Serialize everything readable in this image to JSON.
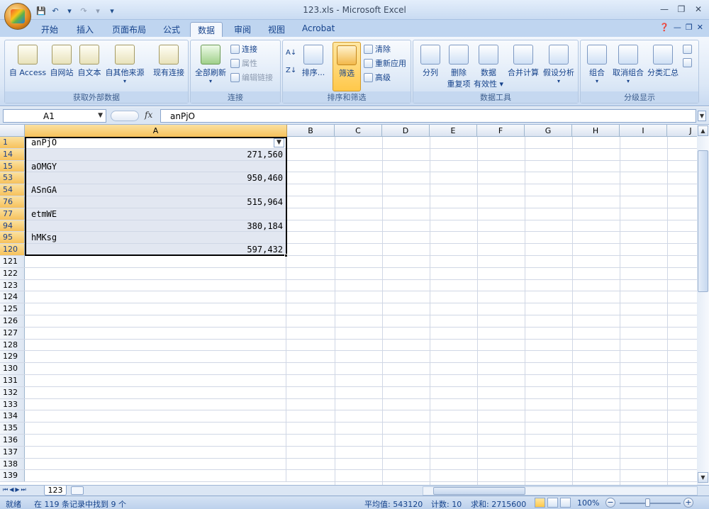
{
  "window": {
    "title": "123.xls - Microsoft Excel"
  },
  "tabs": [
    {
      "label": "开始",
      "active": false
    },
    {
      "label": "插入",
      "active": false
    },
    {
      "label": "页面布局",
      "active": false
    },
    {
      "label": "公式",
      "active": false
    },
    {
      "label": "数据",
      "active": true
    },
    {
      "label": "审阅",
      "active": false
    },
    {
      "label": "视图",
      "active": false
    },
    {
      "label": "Acrobat",
      "active": false
    }
  ],
  "ribbon": {
    "external": {
      "title": "获取外部数据",
      "access": "自 Access",
      "web": "自网站",
      "text": "自文本",
      "other": "自其他来源",
      "existing": "现有连接"
    },
    "connections": {
      "title": "连接",
      "refresh": "全部刷新",
      "connect": "连接",
      "props": "属性",
      "editlinks": "编辑链接"
    },
    "sortfilter": {
      "title": "排序和筛选",
      "sort": "排序...",
      "filter": "筛选",
      "clear": "清除",
      "reapply": "重新应用",
      "advanced": "高级"
    },
    "datatools": {
      "title": "数据工具",
      "split": "分列",
      "remove_dup_1": "删除",
      "remove_dup_2": "重复项",
      "validation_1": "数据",
      "validation_2": "有效性",
      "consolidate": "合并计算",
      "whatif": "假设分析"
    },
    "outline": {
      "title": "分级显示",
      "group": "组合",
      "ungroup": "取消组合",
      "subtotal": "分类汇总"
    }
  },
  "formula_bar": {
    "name_box": "A1",
    "fx": "fx",
    "content": "anPjO"
  },
  "columns": [
    "A",
    "B",
    "C",
    "D",
    "E",
    "F",
    "G",
    "H",
    "I",
    "J"
  ],
  "rows": [
    {
      "num": "1",
      "a": "anPjO",
      "numeric": false
    },
    {
      "num": "14",
      "a": "271,560",
      "numeric": true
    },
    {
      "num": "15",
      "a": "aOMGY",
      "numeric": false
    },
    {
      "num": "53",
      "a": "950,460",
      "numeric": true
    },
    {
      "num": "54",
      "a": "ASnGA",
      "numeric": false
    },
    {
      "num": "76",
      "a": "515,964",
      "numeric": true
    },
    {
      "num": "77",
      "a": "etmWE",
      "numeric": false
    },
    {
      "num": "94",
      "a": "380,184",
      "numeric": true
    },
    {
      "num": "95",
      "a": "hMKsg",
      "numeric": false
    },
    {
      "num": "120",
      "a": "597,432",
      "numeric": true
    },
    {
      "num": "121",
      "a": ""
    },
    {
      "num": "122",
      "a": ""
    },
    {
      "num": "123",
      "a": ""
    },
    {
      "num": "124",
      "a": ""
    },
    {
      "num": "125",
      "a": ""
    },
    {
      "num": "126",
      "a": ""
    },
    {
      "num": "127",
      "a": ""
    },
    {
      "num": "128",
      "a": ""
    },
    {
      "num": "129",
      "a": ""
    },
    {
      "num": "130",
      "a": ""
    },
    {
      "num": "131",
      "a": ""
    },
    {
      "num": "132",
      "a": ""
    },
    {
      "num": "133",
      "a": ""
    },
    {
      "num": "134",
      "a": ""
    },
    {
      "num": "135",
      "a": ""
    },
    {
      "num": "136",
      "a": ""
    },
    {
      "num": "137",
      "a": ""
    },
    {
      "num": "138",
      "a": ""
    },
    {
      "num": "139",
      "a": ""
    }
  ],
  "sheet": {
    "tab": "123"
  },
  "status": {
    "mode": "就绪",
    "filter_info": "在 119 条记录中找到 9 个",
    "average": "平均值: 543120",
    "count": "计数: 10",
    "sum": "求和: 2715600",
    "zoom": "100%"
  },
  "colors": {
    "accent": "#15428b",
    "selection": "#f6c15b",
    "filter_active": "#f2b84a"
  }
}
